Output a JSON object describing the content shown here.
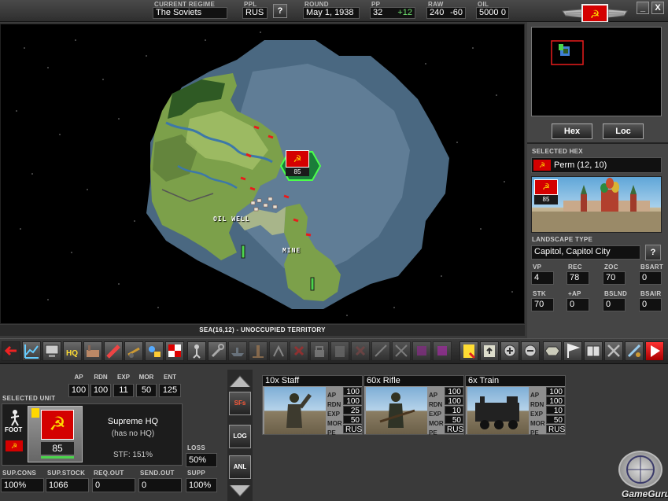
{
  "header": {
    "regime_label": "CURRENT REGIME",
    "regime": "The Soviets",
    "ppl_label": "PPL",
    "ppl": "RUS",
    "round_label": "ROUND",
    "round": "May 1, 1938",
    "pp_label": "PP",
    "pp": "32",
    "pp_delta": "+12",
    "raw_label": "RAW",
    "raw": "240",
    "raw_delta": "-60",
    "oil_label": "OIL",
    "oil": "5000",
    "oil_delta": "0",
    "help": "?",
    "minimize": "_",
    "close": "X"
  },
  "map": {
    "caption": "SEA(16,12) - UNOCCUPIED TERRITORY",
    "oil_well_label": "OIL WELL",
    "mine_label": "MINE",
    "unit_strength": "85"
  },
  "right_panel": {
    "hex_button": "Hex",
    "loc_button": "Loc",
    "selected_hex_label": "SELECTED HEX",
    "selected_hex": "Perm (12, 10)",
    "preview_strength": "85",
    "landscape_label": "LANDSCAPE TYPE",
    "landscape": "Capitol, Capitol City",
    "help": "?",
    "stats_row1": [
      {
        "label": "VP",
        "value": "4"
      },
      {
        "label": "REC",
        "value": "78"
      },
      {
        "label": "ZOC",
        "value": "70"
      },
      {
        "label": "BSART",
        "value": "0"
      }
    ],
    "stats_row2": [
      {
        "label": "STK",
        "value": "70"
      },
      {
        "label": "+AP",
        "value": "0"
      },
      {
        "label": "BSLND",
        "value": "0"
      },
      {
        "label": "BSAIR",
        "value": "0"
      }
    ]
  },
  "selected_unit": {
    "label": "SELECTED UNIT",
    "stats": [
      {
        "label": "AP",
        "value": "100"
      },
      {
        "label": "RDN",
        "value": "100"
      },
      {
        "label": "EXP",
        "value": "11"
      },
      {
        "label": "MOR",
        "value": "50"
      },
      {
        "label": "ENT",
        "value": "125"
      }
    ],
    "type": "FOOT",
    "strength": "85",
    "name": "Supreme HQ",
    "hq": "(has no HQ)",
    "stf": "STF: 151%",
    "loss_label": "LOSS",
    "loss": "50%",
    "supp_label": "SUPP",
    "supp": "100%",
    "bottom_stats": [
      {
        "label": "SUP.CONS",
        "value": "100%"
      },
      {
        "label": "SUP.STOCK",
        "value": "1066"
      },
      {
        "label": "REQ.OUT",
        "value": "0"
      },
      {
        "label": "SEND.OUT",
        "value": "0"
      }
    ]
  },
  "side_buttons": [
    "SFs",
    "LOG",
    "ANL"
  ],
  "units": [
    {
      "title": "10x Staff",
      "stats": [
        [
          "AP",
          "100"
        ],
        [
          "RDN",
          "100"
        ],
        [
          "EXP",
          "25"
        ],
        [
          "MOR",
          "50"
        ],
        [
          "PE",
          "RUS"
        ]
      ]
    },
    {
      "title": "60x Rifle",
      "stats": [
        [
          "AP",
          "100"
        ],
        [
          "RDN",
          "100"
        ],
        [
          "EXP",
          "10"
        ],
        [
          "MOR",
          "50"
        ],
        [
          "PE",
          "RUS"
        ]
      ]
    },
    {
      "title": "6x Train",
      "stats": [
        [
          "AP",
          "100"
        ],
        [
          "RDN",
          "100"
        ],
        [
          "EXP",
          "10"
        ],
        [
          "MOR",
          "50"
        ],
        [
          "PE",
          "RUS"
        ]
      ]
    }
  ],
  "watermark": "GameGuru",
  "colors": {
    "soviet_red": "#d40000",
    "map_green": "#7ca04a",
    "sea": "#4a6a85",
    "panel": "#454545"
  }
}
